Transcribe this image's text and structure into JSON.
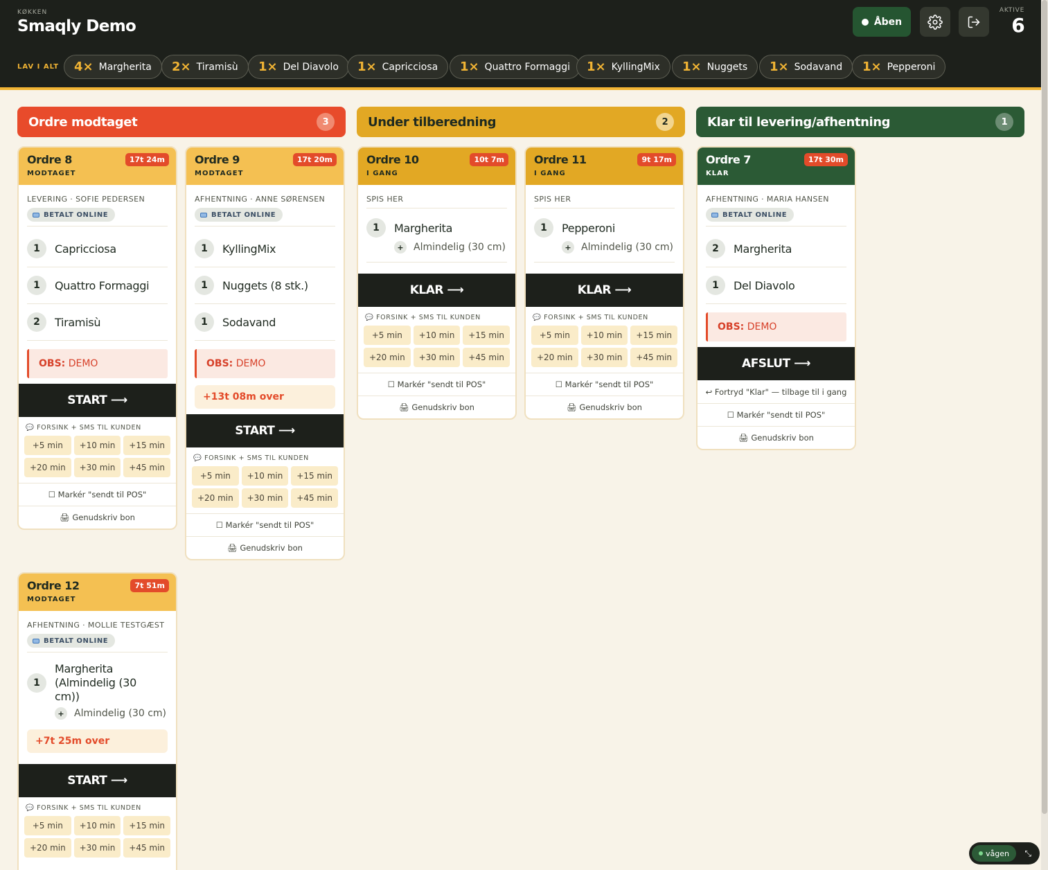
{
  "header": {
    "kicker": "KØKKEN",
    "title": "Smaqly Demo",
    "open_button": "Åben",
    "active_label": "AKTIVE",
    "active_count": "6"
  },
  "summary": {
    "label": "LAV I ALT",
    "chips": [
      {
        "qty": "4×",
        "name": "Margherita"
      },
      {
        "qty": "2×",
        "name": "Tiramisù"
      },
      {
        "qty": "1×",
        "name": "Del Diavolo"
      },
      {
        "qty": "1×",
        "name": "Capricciosa"
      },
      {
        "qty": "1×",
        "name": "Quattro Formaggi"
      },
      {
        "qty": "1×",
        "name": "KyllingMix"
      },
      {
        "qty": "1×",
        "name": "Nuggets"
      },
      {
        "qty": "1×",
        "name": "Sodavand"
      },
      {
        "qty": "1×",
        "name": "Pepperoni"
      }
    ]
  },
  "columns": [
    {
      "title": "Ordre modtaget",
      "count": "3"
    },
    {
      "title": "Under tilberedning",
      "count": "2"
    },
    {
      "title": "Klar til levering/afhentning",
      "count": "1"
    }
  ],
  "delay": {
    "label": "FORSINK + SMS TIL KUNDEN",
    "options": [
      "+5 min",
      "+10 min",
      "+15 min",
      "+20 min",
      "+30 min",
      "+45 min"
    ]
  },
  "actions": {
    "mark_pos": "☐ Markér \"sendt til POS\"",
    "reprint": "🖨 Genudskriv bon",
    "undo_ready": "↩ Fortryd \"Klar\" — tilbage til i gang"
  },
  "orders": [
    {
      "title": "Ordre 8",
      "status": "MODTAGET",
      "timer": "17t 24m",
      "meta": "LEVERING · SOFIE PEDERSEN",
      "paid": "BETALT ONLINE",
      "items": [
        {
          "qty": "1",
          "name": "Capricciosa"
        },
        {
          "qty": "1",
          "name": "Quattro Formaggi"
        },
        {
          "qty": "2",
          "name": "Tiramisù"
        }
      ],
      "note_label": "OBS:",
      "note": "DEMO",
      "button": "START"
    },
    {
      "title": "Ordre 9",
      "status": "MODTAGET",
      "timer": "17t 20m",
      "meta": "AFHENTNING · ANNE SØRENSEN",
      "paid": "BETALT ONLINE",
      "items": [
        {
          "qty": "1",
          "name": "KyllingMix"
        },
        {
          "qty": "1",
          "name": "Nuggets (8 stk.)"
        },
        {
          "qty": "1",
          "name": "Sodavand"
        }
      ],
      "note_label": "OBS:",
      "note": "DEMO",
      "overdue": "+13t 08m over",
      "button": "START"
    },
    {
      "title": "Ordre 10",
      "status": "I GANG",
      "timer": "10t 7m",
      "meta": "SPIS HER",
      "items": [
        {
          "qty": "1",
          "name": "Margherita",
          "modifier": "Almindelig (30 cm)"
        }
      ],
      "button": "KLAR"
    },
    {
      "title": "Ordre 11",
      "status": "I GANG",
      "timer": "9t 17m",
      "meta": "SPIS HER",
      "items": [
        {
          "qty": "1",
          "name": "Pepperoni",
          "modifier": "Almindelig (30 cm)"
        }
      ],
      "button": "KLAR"
    },
    {
      "title": "Ordre 7",
      "status": "KLAR",
      "timer": "17t 30m",
      "meta": "AFHENTNING · MARIA HANSEN",
      "paid": "BETALT ONLINE",
      "items": [
        {
          "qty": "2",
          "name": "Margherita"
        },
        {
          "qty": "1",
          "name": "Del Diavolo"
        }
      ],
      "note_label": "OBS:",
      "note": "DEMO",
      "button": "AFSLUT"
    },
    {
      "title": "Ordre 12",
      "status": "MODTAGET",
      "timer": "7t 51m",
      "meta": "AFHENTNING · MOLLIE TESTGÆST",
      "paid": "BETALT ONLINE",
      "items": [
        {
          "qty": "1",
          "name": "Margherita (Almindelig (30 cm))",
          "modifier": "Almindelig (30 cm)"
        }
      ],
      "overdue": "+7t 25m over",
      "button": "START"
    }
  ],
  "live": {
    "label": "vågen"
  },
  "colors": {
    "received": "#e84b2b",
    "preparing": "#e2a824",
    "ready": "#2b5a35",
    "card_received": "#f4c052"
  }
}
